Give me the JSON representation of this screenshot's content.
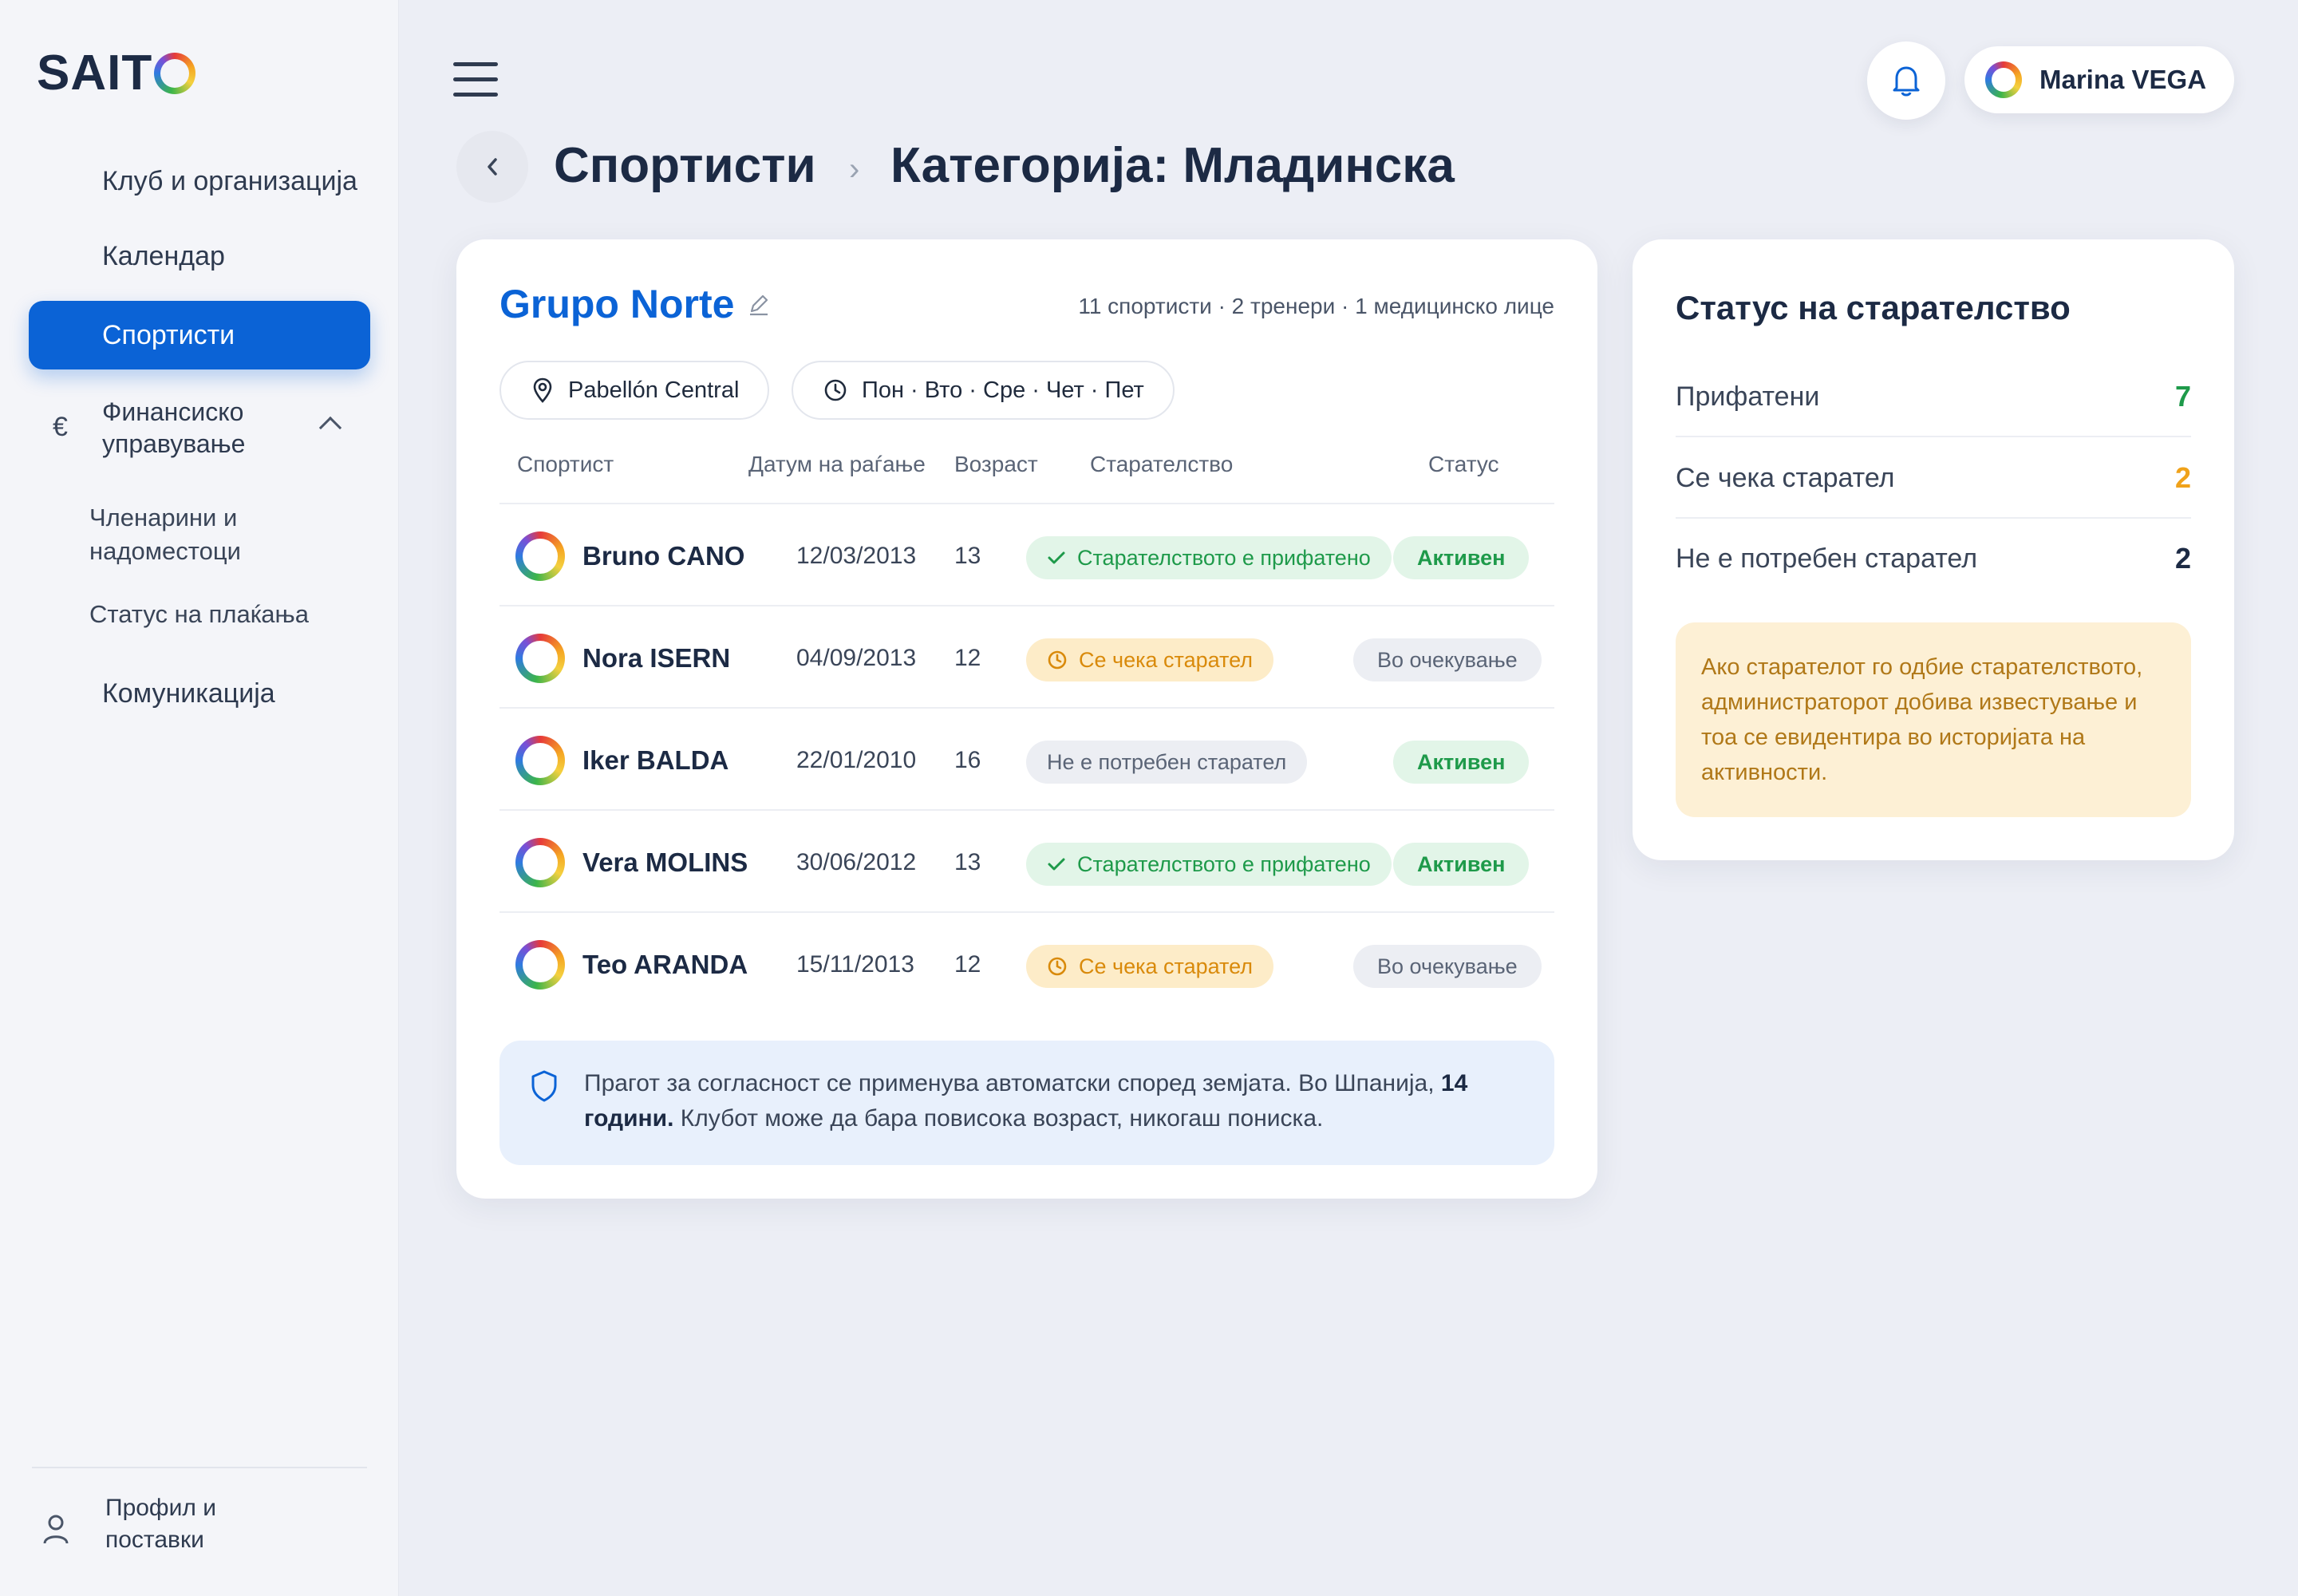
{
  "brand": {
    "name": "SAITO",
    "name_prefix": "SAIT"
  },
  "sidebar": {
    "items": [
      {
        "label": "Клуб и организација"
      },
      {
        "label": "Календар"
      },
      {
        "label": "Спортисти",
        "active": true
      },
      {
        "label": "Финансиско управување",
        "icon": "euro-icon",
        "expanded": true
      },
      {
        "label": "Членарини и надоместоци"
      },
      {
        "label": "Статус на плаќања"
      },
      {
        "label": "Комуникација"
      }
    ],
    "profile_label": "Профил и поставки"
  },
  "header": {
    "user_name": "Marina VEGA",
    "breadcrumb": [
      "Спортисти",
      "Категорија: Младинска"
    ],
    "breadcrumb_separator": "›"
  },
  "group": {
    "name": "Grupo Norte",
    "meta": "11 спортисти · 2 тренери · 1 медицинско лице",
    "location": "Pabellón Central",
    "schedule": "Пон · Вто · Сре · Чет · Пет"
  },
  "table": {
    "columns": [
      "Спортист",
      "Датум на раѓање",
      "Возраст",
      "Старателство",
      "Статус"
    ],
    "rows": [
      {
        "name": "Bruno CANO",
        "dob": "12/03/2013",
        "age": "13",
        "guardian": "Старателството е прифатено",
        "guardian_state": "ok",
        "status": "Активен",
        "status_state": "active"
      },
      {
        "name": "Nora ISERN",
        "dob": "04/09/2013",
        "age": "12",
        "guardian": "Се чека старател",
        "guardian_state": "wait",
        "status": "Во очекување",
        "status_state": "pending"
      },
      {
        "name": "Iker BALDA",
        "dob": "22/01/2010",
        "age": "16",
        "guardian": "Не е потребен старател",
        "guardian_state": "none",
        "status": "Активен",
        "status_state": "active"
      },
      {
        "name": "Vera MOLINS",
        "dob": "30/06/2012",
        "age": "13",
        "guardian": "Старателството е прифатено",
        "guardian_state": "ok",
        "status": "Активен",
        "status_state": "active"
      },
      {
        "name": "Teo ARANDA",
        "dob": "15/11/2013",
        "age": "12",
        "guardian": "Се чека старател",
        "guardian_state": "wait",
        "status": "Во очекување",
        "status_state": "pending"
      }
    ]
  },
  "notice": {
    "text_before": "Прагот за согласност се применува автоматски според земјата. Во Шпанија, ",
    "text_bold": "14 години.",
    "text_after": " Клубот може да бара повисока возраст, никогаш пониска."
  },
  "guardianship_status": {
    "title": "Статус на старателство",
    "rows": [
      {
        "label": "Прифатени",
        "value": "7",
        "color": "#1e9a4a"
      },
      {
        "label": "Се чека старател",
        "value": "2",
        "color": "#f0a21a"
      },
      {
        "label": "Не е потребен старател",
        "value": "2",
        "color": "#1c2a44"
      }
    ],
    "note": "Ако старателот го одбие старателството, администраторот добива известување и тоа се евидентира во историјата на активности."
  },
  "colors": {
    "accent": "#0b63d6",
    "success": "#1e9a4a",
    "warning": "#f0a21a"
  }
}
